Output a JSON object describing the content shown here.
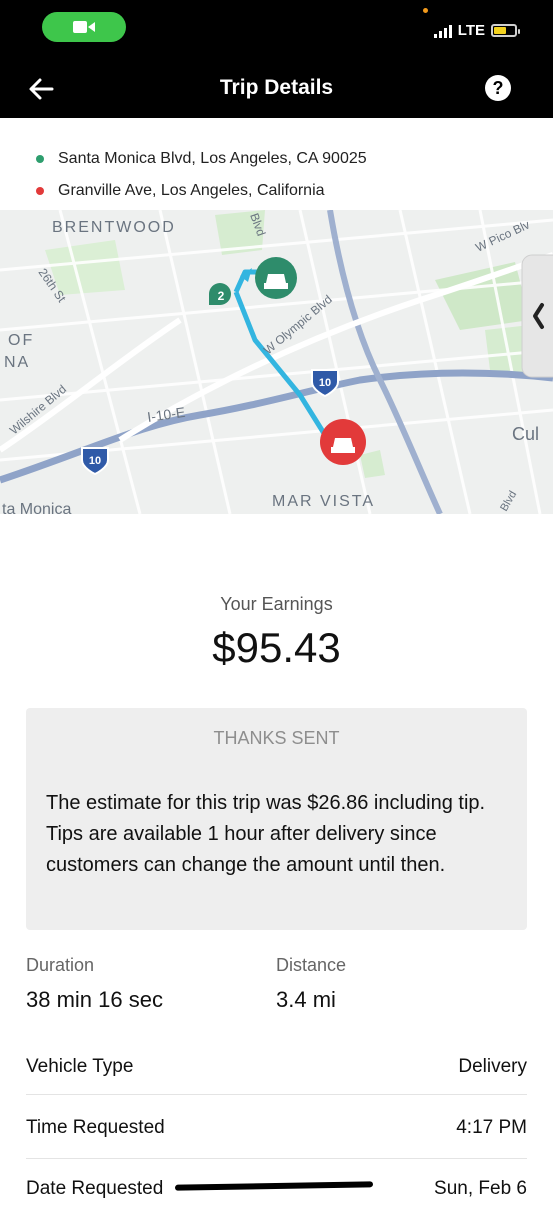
{
  "status": {
    "network": "LTE"
  },
  "header": {
    "title": "Trip Details"
  },
  "trip": {
    "pickup": "Santa Monica Blvd, Los Angeles, CA 90025",
    "dropoff": "Granville Ave, Los Angeles, California",
    "pickup_color": "#2e9e6e",
    "dropoff_color": "#e23a3a"
  },
  "map": {
    "labels": {
      "brentwood": "BRENTWOOD",
      "blvd_top": "Blvd",
      "w_pico": "W Pico Blv",
      "st26": "26th St",
      "of": "OF",
      "na": "NA",
      "w_olympic": "W Olympic Blvd",
      "wilshire": "Wilshire Blvd",
      "i10e": "I-10-E",
      "culv": "Cul",
      "monica": "ta Monica",
      "mar_vista": "MAR VISTA",
      "blvd_bottom": "Blvd"
    },
    "route_step": "2",
    "shield_a": "10",
    "shield_b": "10"
  },
  "earnings": {
    "label": "Your Earnings",
    "amount": "$95.43"
  },
  "notice": {
    "status": "THANKS SENT",
    "text": "The estimate for this trip was $26.86 including tip. Tips are available 1 hour after delivery since customers can change the amount until then."
  },
  "stats": {
    "duration_label": "Duration",
    "duration_value": "38 min 16 sec",
    "distance_label": "Distance",
    "distance_value": "3.4 mi"
  },
  "details": [
    {
      "key": "Vehicle Type",
      "value": "Delivery"
    },
    {
      "key": "Time Requested",
      "value": "4:17 PM"
    },
    {
      "key": "Date Requested",
      "value": "Sun, Feb 6"
    }
  ]
}
